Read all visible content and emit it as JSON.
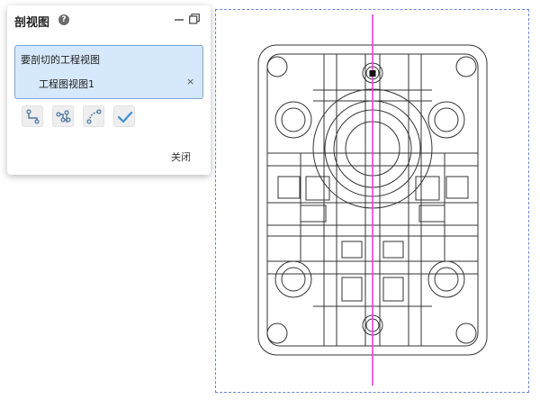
{
  "panel": {
    "title": "剖视图",
    "help_glyph": "?",
    "selection_label": "要剖切的工程视图",
    "selected_item": "工程图视图1",
    "remove_glyph": "×",
    "close_label": "关闭",
    "tools": [
      {
        "name": "section-line-point-icon"
      },
      {
        "name": "section-multi-point-icon"
      },
      {
        "name": "section-arc-icon"
      },
      {
        "name": "confirm-check-icon"
      }
    ]
  },
  "colors": {
    "accent": "#7ea6d6",
    "selection_fill": "#d6e8fb",
    "section_line": "#e040d0",
    "view_frame": "#6f86d8",
    "tool_icon": "#2f5f8f",
    "check": "#3b8fd6"
  }
}
